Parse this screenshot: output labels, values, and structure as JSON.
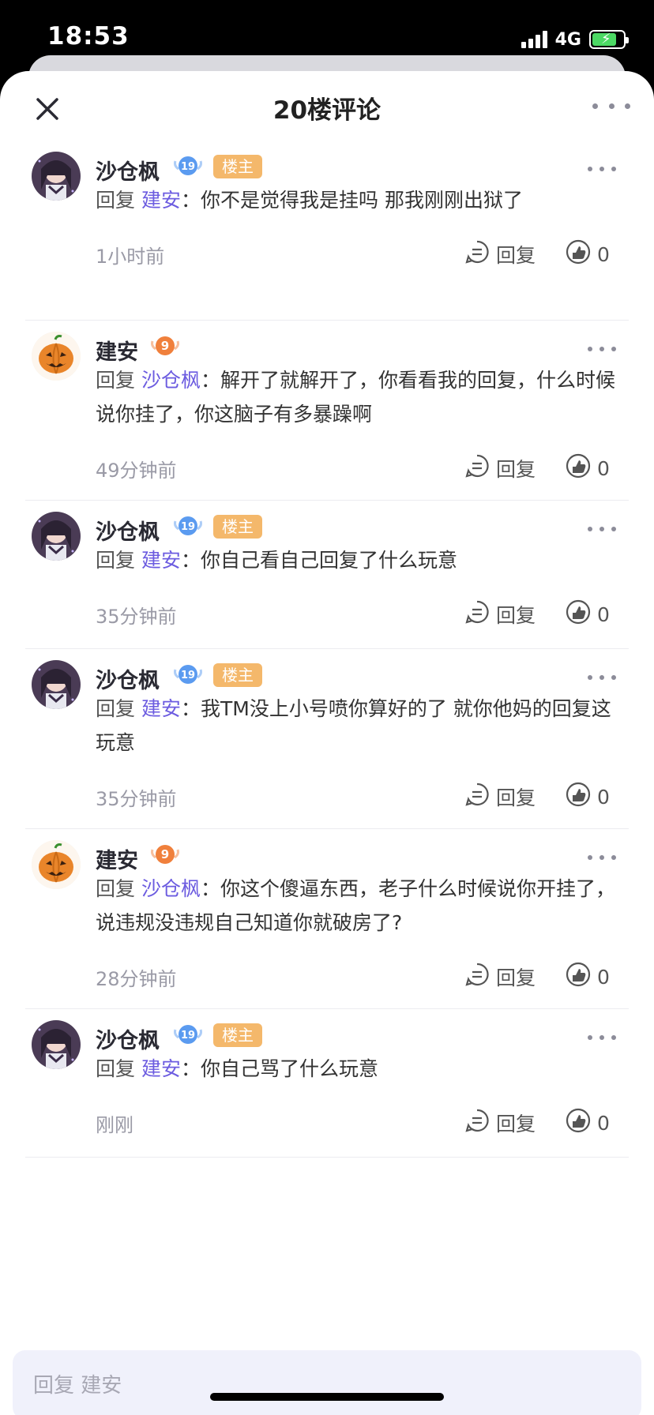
{
  "status_bar": {
    "time": "18:53",
    "network": "4G",
    "battery_level": 0.8
  },
  "header": {
    "title": "20楼评论",
    "close_icon": "close-icon",
    "more_icon": "more-horizontal-icon"
  },
  "labels": {
    "reply_action": "回复",
    "reply_prefix": "回复",
    "colon": "：",
    "owner_tag": "楼主"
  },
  "comments": [
    {
      "author": "沙仓枫",
      "level": "19",
      "is_owner": true,
      "avatar": "anime-girl-avatar",
      "reply_to": "建安",
      "text": "你不是觉得我是挂吗 那我刚刚出狱了",
      "time": "1小时前",
      "likes": "0"
    },
    {
      "author": "建安",
      "level": "9",
      "is_owner": false,
      "avatar": "pumpkin-avatar",
      "reply_to": "沙仓枫",
      "text": "解开了就解开了，你看看我的回复，什么时候说你挂了，你这脑子有多暴躁啊",
      "time": "49分钟前",
      "likes": "0"
    },
    {
      "author": "沙仓枫",
      "level": "19",
      "is_owner": true,
      "avatar": "anime-girl-avatar",
      "reply_to": "建安",
      "text": "你自己看自己回复了什么玩意",
      "time": "35分钟前",
      "likes": "0"
    },
    {
      "author": "沙仓枫",
      "level": "19",
      "is_owner": true,
      "avatar": "anime-girl-avatar",
      "reply_to": "建安",
      "text": "我TM没上小号喷你算好的了 就你他妈的回复这玩意",
      "time": "35分钟前",
      "likes": "0"
    },
    {
      "author": "建安",
      "level": "9",
      "is_owner": false,
      "avatar": "pumpkin-avatar",
      "reply_to": "沙仓枫",
      "text": "你这个傻逼东西，老子什么时候说你开挂了，说违规没违规自己知道你就破房了?",
      "time": "28分钟前",
      "likes": "0"
    },
    {
      "author": "沙仓枫",
      "level": "19",
      "is_owner": true,
      "avatar": "anime-girl-avatar",
      "reply_to": "建安",
      "text": "你自己骂了什么玩意",
      "time": "刚刚",
      "likes": "0"
    }
  ],
  "reply_input": {
    "placeholder": "回复 建安"
  },
  "colors": {
    "accent": "#6c5ce0",
    "owner_tag": "#f4b86b",
    "level_19": "#5b9bf0",
    "level_9": "#f0803c",
    "input_bg": "#f0f1fb"
  }
}
